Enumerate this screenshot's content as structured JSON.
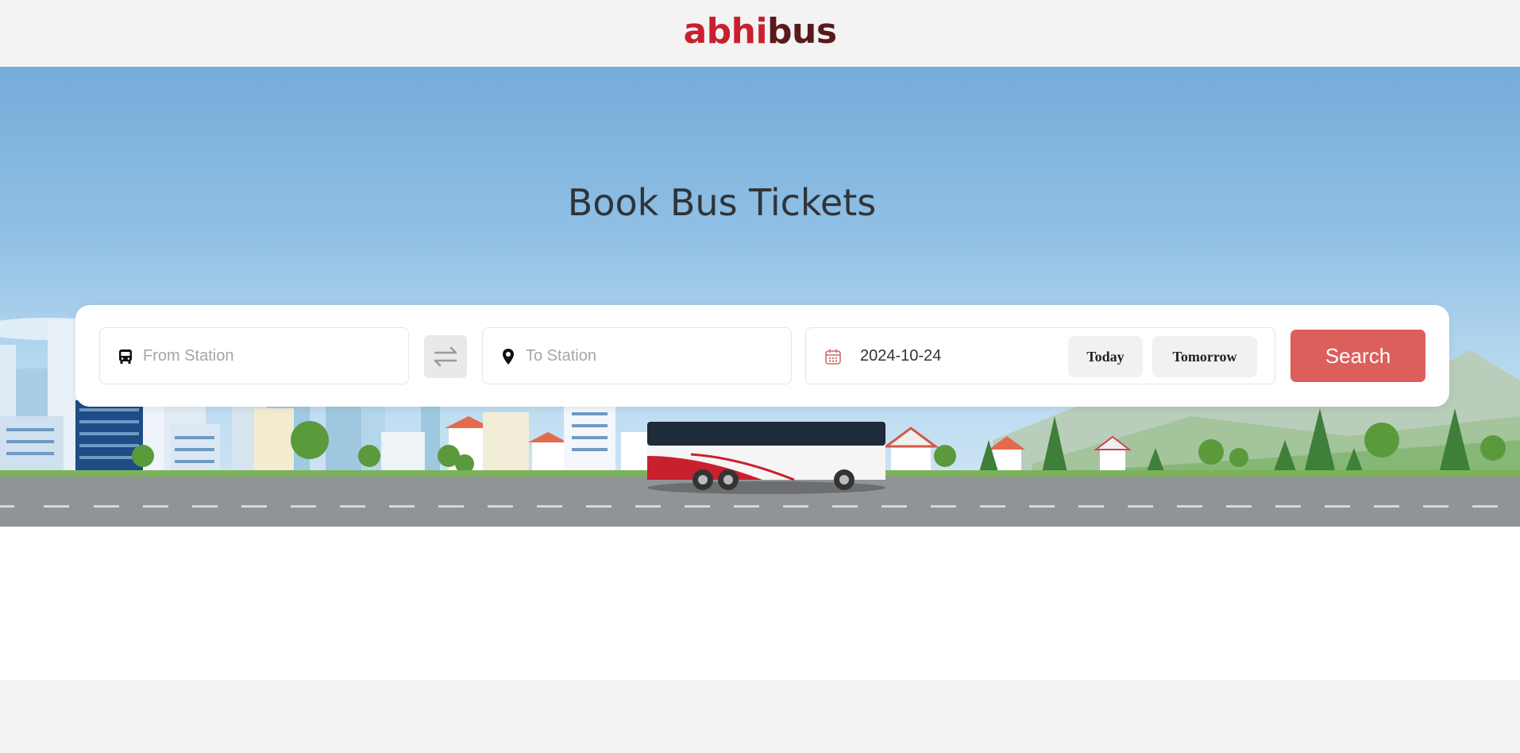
{
  "brand": {
    "part1": "abhi",
    "part2": "bus"
  },
  "hero": {
    "title": "Book Bus Tickets"
  },
  "search_form": {
    "from_placeholder": "From Station",
    "to_placeholder": "To Station",
    "date_value": "2024-10-24",
    "today_label": "Today",
    "tomorrow_label": "Tomorrow",
    "search_label": "Search"
  },
  "colors": {
    "brand_red": "#c8202f",
    "brand_dark": "#5a1a1a",
    "search_button": "#dc5f5b"
  }
}
